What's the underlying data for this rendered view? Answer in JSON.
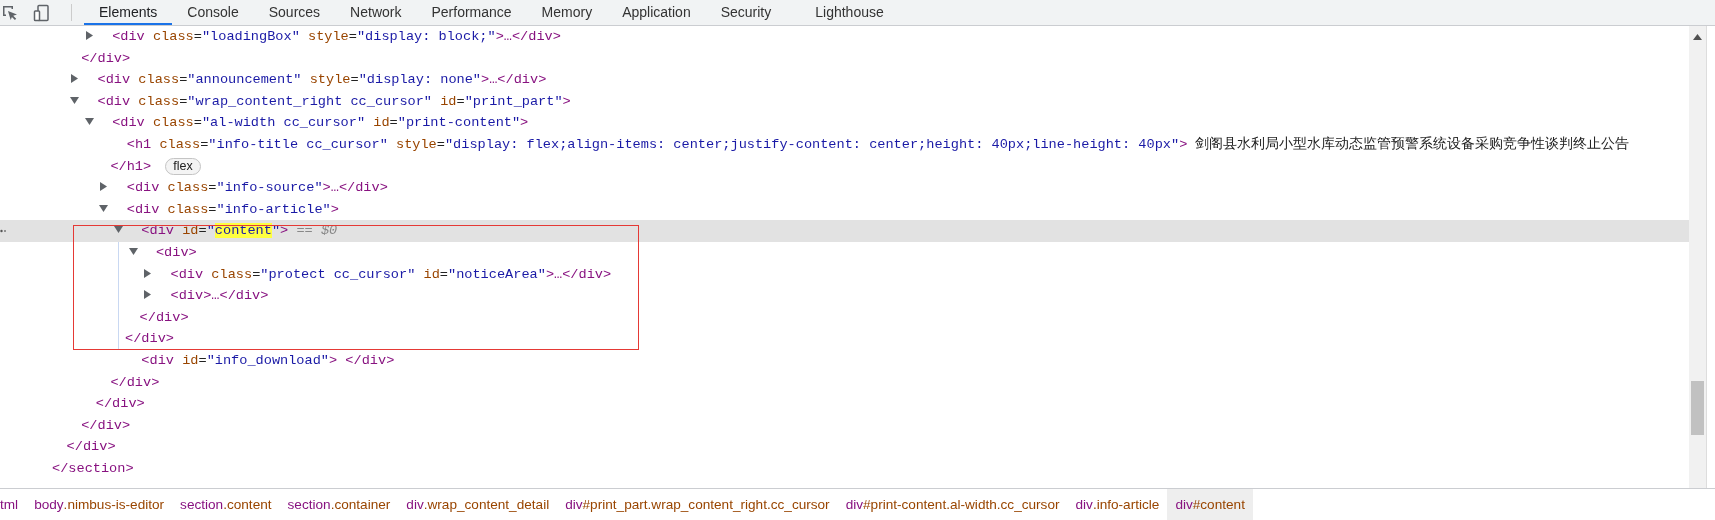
{
  "tabs": [
    {
      "label": "Elements",
      "selected": true
    },
    {
      "label": "Console",
      "selected": false
    },
    {
      "label": "Sources",
      "selected": false
    },
    {
      "label": "Network",
      "selected": false
    },
    {
      "label": "Performance",
      "selected": false
    },
    {
      "label": "Memory",
      "selected": false
    },
    {
      "label": "Application",
      "selected": false
    },
    {
      "label": "Security",
      "selected": false
    },
    {
      "label": "Lighthouse",
      "selected": false
    }
  ],
  "elements_tree": [
    {
      "close": "</section>",
      "children": [
        {
          "close": "</div>",
          "children": [
            {
              "close": "</div>",
              "children": [
                {
                  "open": [
                    {
                      "text": "<div class=\"loadingBox\" style=\"display: block;\">…</div>",
                      "highlighted": false
                    }
                  ],
                  "expanded": false,
                  "selected": false,
                  "outlined": false
                }
              ]
            },
            {
              "open": [
                {
                  "text": "<div class=\"announcement\" style=\"display: none\">…</div>",
                  "highlighted": false
                }
              ],
              "expanded": false,
              "selected": false,
              "outlined": false
            },
            {
              "open": [
                {
                  "text": "<div class=\"wrap_content_right cc_cursor\" id=\"print_part\">",
                  "highlighted": false
                }
              ],
              "expanded": true,
              "selected": false,
              "outlined": false,
              "close": "</div>",
              "children": [
                {
                  "open": [
                    {
                      "text": "<div class=\"al-width cc_cursor\" id=\"print-content\">",
                      "highlighted": false
                    }
                  ],
                  "expanded": true,
                  "selected": false,
                  "outlined": false,
                  "close": "</div>",
                  "children": [
                    {
                      "open": [
                        {
                          "text": "<h1 class=\"info-title cc_cursor\" style=\"display: flex;align-items: center;justify-content: center;height: 40px;line-height: 40px\"> 剑阁县水利局小型水库动态监管预警系统设备采购竞争性谈判终止公告",
                          "highlighted": false
                        }
                      ],
                      "selected": false,
                      "outlined": false,
                      "close": "</h1>",
                      "badge": "flex"
                    },
                    {
                      "open": [
                        {
                          "text": "<div class=\"info-source\">…</div>",
                          "highlighted": false
                        }
                      ],
                      "expanded": false,
                      "selected": false,
                      "outlined": false
                    },
                    {
                      "open": [
                        {
                          "text": "<div class=\"info-article\">",
                          "highlighted": false
                        }
                      ],
                      "expanded": true,
                      "selected": false,
                      "outlined": false,
                      "close": "</div>",
                      "children": [
                        {
                          "open": [
                            {
                              "text": "<div id=\""
                            },
                            {
                              "text": "content",
                              "highlighted": true
                            },
                            {
                              "text": "\"> == $0"
                            }
                          ],
                          "expanded": true,
                          "selected": true,
                          "outlined": true,
                          "close": "</div>",
                          "children": [
                            {
                              "open": [
                                {
                                  "text": "<div>",
                                  "highlighted": false
                                }
                              ],
                              "expanded": true,
                              "selected": false,
                              "outlined": false,
                              "close": "</div>",
                              "children": [
                                {
                                  "open": [
                                    {
                                      "text": "<div class=\"protect cc_cursor\" id=\"noticeArea\">…</div>",
                                      "highlighted": false
                                    }
                                  ],
                                  "expanded": false,
                                  "selected": false,
                                  "outlined": false
                                },
                                {
                                  "open": [
                                    {
                                      "text": "<div>…</div>",
                                      "highlighted": false
                                    }
                                  ],
                                  "expanded": false,
                                  "selected": false,
                                  "outlined": false
                                }
                              ]
                            }
                          ]
                        },
                        {
                          "open": [
                            {
                              "text": "<div id=\"info_download\"> </div>",
                              "highlighted": false
                            }
                          ],
                          "selected": false,
                          "outlined": false
                        }
                      ]
                    }
                  ]
                }
              ]
            }
          ]
        }
      ]
    }
  ],
  "breadcrumbs": [
    {
      "tag": "tml",
      "selected": false
    },
    {
      "tag": "body",
      "rest": ".nimbus-is-editor",
      "selected": false
    },
    {
      "tag": "section",
      "rest": ".content",
      "selected": false
    },
    {
      "tag": "section",
      "rest": ".container",
      "selected": false
    },
    {
      "tag": "div",
      "rest": ".wrap_content_detail",
      "selected": false
    },
    {
      "tag": "div",
      "rest": "#print_part.wrap_content_right.cc_cursor",
      "selected": false
    },
    {
      "tag": "div",
      "rest": "#print-content.al-width.cc_cursor",
      "selected": false
    },
    {
      "tag": "div",
      "rest": ".info-article",
      "selected": false
    },
    {
      "tag": "div",
      "rest": "#content",
      "selected": true
    }
  ]
}
